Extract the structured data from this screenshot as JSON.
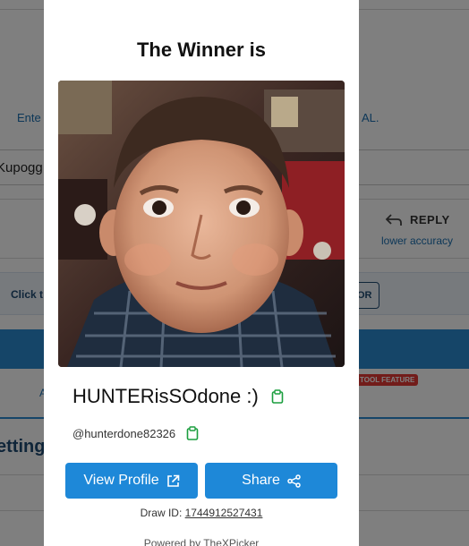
{
  "background": {
    "instruction_left": "Ente",
    "instruction_right": "AL.",
    "input_value": "Kupogg",
    "reply_label": "REPLY",
    "accuracy_label": "lower accuracy",
    "bar_label": "Click t",
    "bar_button_label": "OR",
    "tool_badge": "TOOL FEATURE",
    "tab_label": "A",
    "settings_heading": "etting"
  },
  "modal": {
    "title": "The Winner is",
    "winner_name": "HUNTERisSOdone :)",
    "winner_handle": "@hunterdone82326",
    "view_profile_label": "View Profile",
    "share_label": "Share",
    "draw_id_label": "Draw ID:",
    "draw_id_value": "1744912527431",
    "powered_by": "Powered by TheXPicker"
  },
  "colors": {
    "primary": "#1e88d8",
    "copy_icon": "#1b9e3e",
    "overlay": "rgba(0,0,0,0.5)",
    "tool_badge": "#e53935"
  },
  "icons": {
    "copy": "clipboard-icon",
    "external": "external-link-icon",
    "share": "share-icon",
    "reply": "reply-arrow-icon"
  }
}
